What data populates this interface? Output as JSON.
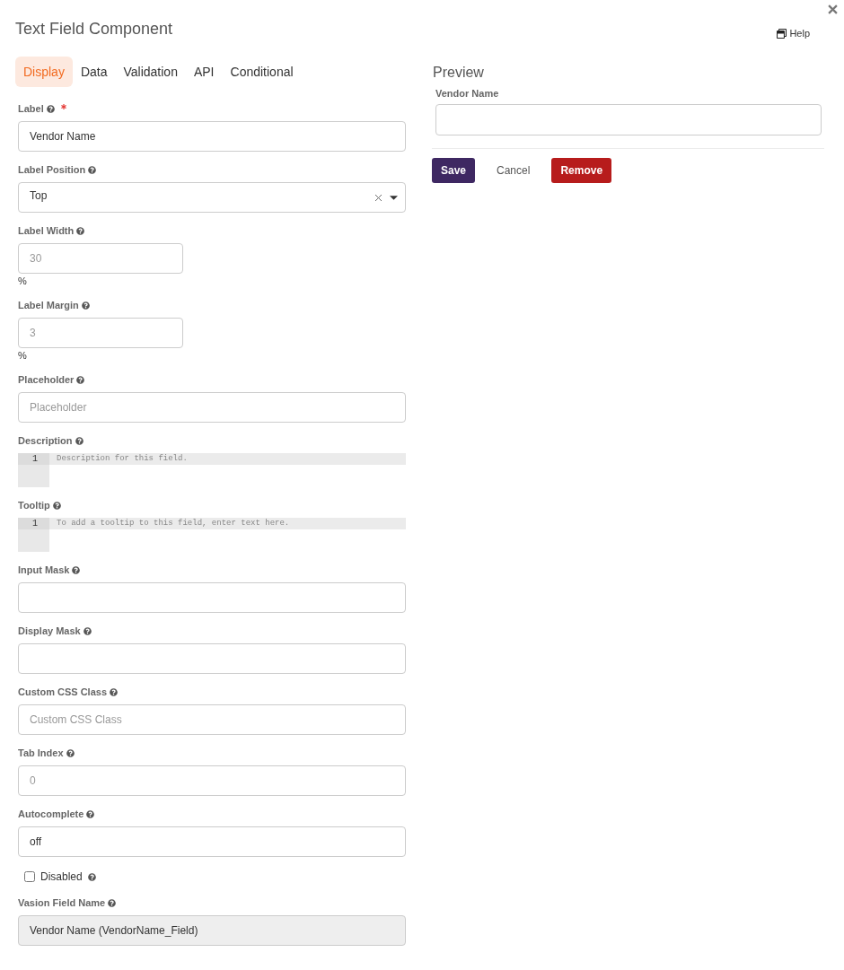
{
  "dialog": {
    "title": "Text Field Component",
    "help_link": "Help"
  },
  "tabs": [
    {
      "label": "Display",
      "selected": true
    },
    {
      "label": "Data",
      "selected": false
    },
    {
      "label": "Validation",
      "selected": false
    },
    {
      "label": "API",
      "selected": false
    },
    {
      "label": "Conditional",
      "selected": false
    }
  ],
  "fields": [
    {
      "kind": "input",
      "label": "Label",
      "required": true,
      "disabled": false,
      "value": "Vendor Name"
    },
    {
      "kind": "select",
      "label": "Label Position",
      "required": false,
      "disabled": false,
      "value": "Top"
    },
    {
      "kind": "number",
      "label": "Label Width",
      "required": false,
      "disabled": false,
      "placeholder": "30",
      "suffix": "%"
    },
    {
      "kind": "number",
      "label": "Label Margin",
      "required": false,
      "disabled": false,
      "placeholder": "3",
      "suffix": "%"
    },
    {
      "kind": "input",
      "label": "Placeholder",
      "required": false,
      "disabled": false,
      "placeholder": "Placeholder"
    },
    {
      "kind": "editor",
      "label": "Description",
      "required": false,
      "disabled": false,
      "line_number": "1",
      "placeholder": "Description for this field."
    },
    {
      "kind": "editor",
      "label": "Tooltip",
      "required": false,
      "disabled": false,
      "line_number": "1",
      "placeholder": "To add a tooltip to this field, enter text here."
    },
    {
      "kind": "input",
      "label": "Input Mask",
      "required": false,
      "disabled": false
    },
    {
      "kind": "input",
      "label": "Display Mask",
      "required": false,
      "disabled": false
    },
    {
      "kind": "input",
      "label": "Custom CSS Class",
      "required": false,
      "disabled": false,
      "placeholder": "Custom CSS Class"
    },
    {
      "kind": "input",
      "label": "Tab Index",
      "required": false,
      "disabled": false,
      "placeholder": "0"
    },
    {
      "kind": "input",
      "label": "Autocomplete",
      "required": false,
      "disabled": false,
      "value": "off"
    },
    {
      "kind": "checkbox",
      "label": "Disabled",
      "required": false,
      "disabled": false,
      "checked": false
    },
    {
      "kind": "input",
      "label": "Vasion Field Name",
      "required": false,
      "disabled": true,
      "value": "Vendor Name (VendorName_Field)"
    }
  ],
  "preview": {
    "title": "Preview",
    "field_label": "Vendor Name"
  },
  "buttons": [
    {
      "label": "Save",
      "kind": "primary"
    },
    {
      "label": "Cancel",
      "kind": "plain"
    },
    {
      "label": "Remove",
      "kind": "danger"
    }
  ]
}
